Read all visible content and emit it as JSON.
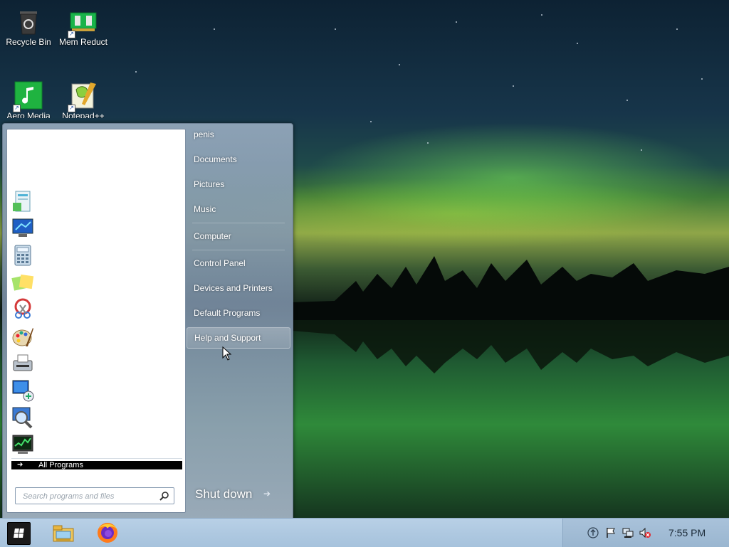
{
  "desktop": {
    "icons": [
      {
        "label": "Recycle Bin",
        "icon": "recycle-bin-icon"
      },
      {
        "label": "Mem Reduct",
        "icon": "mem-reduct-icon"
      },
      {
        "label": "Aero Media",
        "icon": "aero-media-icon"
      },
      {
        "label": "Notepad++",
        "icon": "notepad-plus-plus-icon"
      }
    ]
  },
  "start_menu": {
    "pinned_program_icons": [
      "getting-started-icon",
      "remote-desktop-icon",
      "calculator-icon",
      "sticky-notes-icon",
      "snipping-tool-icon",
      "paint-icon",
      "fax-and-scan-icon",
      "remote-desktop-connection-icon",
      "magnifier-icon",
      "task-manager-icon"
    ],
    "all_programs_label": "All Programs",
    "search": {
      "placeholder": "Search programs and files",
      "value": ""
    },
    "right_items": [
      {
        "label": "penis"
      },
      {
        "label": "Documents"
      },
      {
        "label": "Pictures"
      },
      {
        "label": "Music"
      },
      {
        "label": "Computer"
      },
      {
        "label": "Control Panel"
      },
      {
        "label": "Devices and Printers"
      },
      {
        "label": "Default Programs"
      },
      {
        "label": "Help and Support"
      }
    ],
    "highlighted_item": "Help and Support",
    "shutdown_label": "Shut down"
  },
  "taskbar": {
    "pinned": [
      "file-explorer-icon",
      "firefox-icon"
    ],
    "tray_icons": [
      "upload-arrow-icon",
      "action-center-flag-icon",
      "network-icon",
      "volume-muted-icon"
    ],
    "clock": "7:55 PM"
  }
}
